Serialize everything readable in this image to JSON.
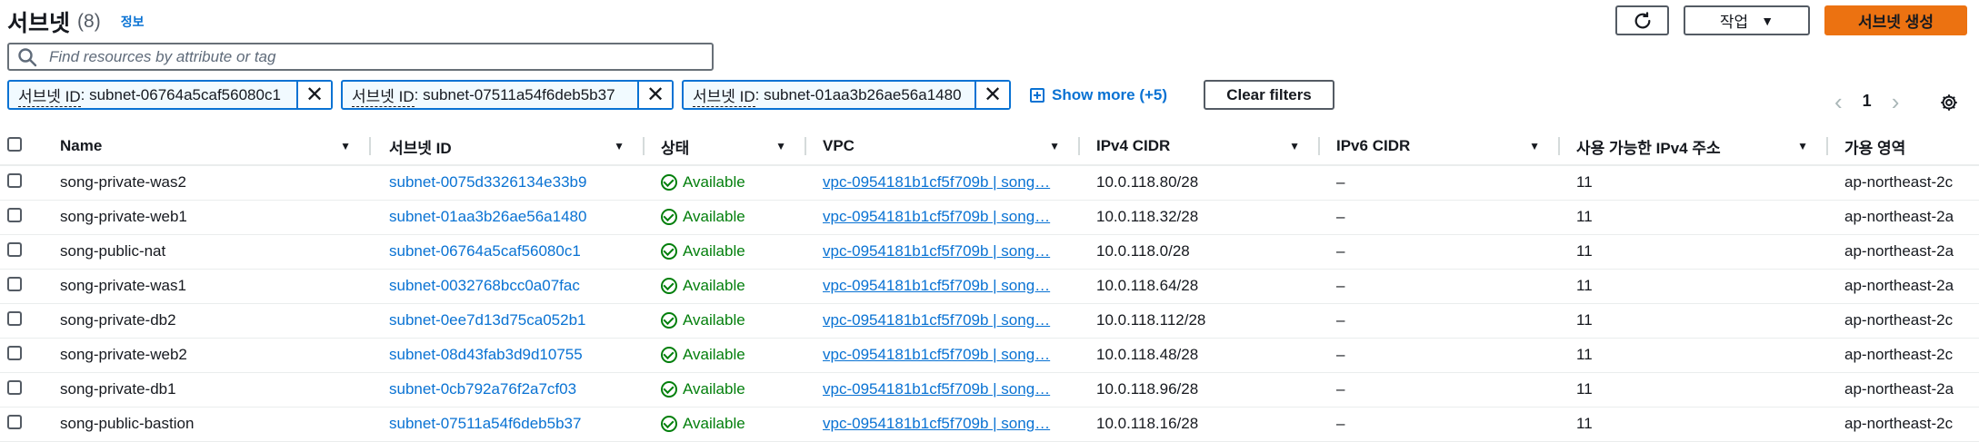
{
  "header": {
    "title": "서브넷",
    "count": "(8)",
    "info_link": "정보",
    "refresh_icon": "refresh-icon",
    "actions_label": "작업",
    "create_label": "서브넷 생성"
  },
  "search": {
    "placeholder": "Find resources by attribute or tag"
  },
  "filters": {
    "tokens": [
      {
        "key": "서브넷 ID",
        "value": " : subnet-06764a5caf56080c1"
      },
      {
        "key": "서브넷 ID",
        "value": " : subnet-07511a54f6deb5b37"
      },
      {
        "key": "서브넷 ID",
        "value": " : subnet-01aa3b26ae56a1480"
      }
    ],
    "show_more": "Show more (+5)",
    "clear_label": "Clear filters"
  },
  "pagination": {
    "page": "1"
  },
  "table": {
    "columns": [
      "Name",
      "서브넷 ID",
      "상태",
      "VPC",
      "IPv4 CIDR",
      "IPv6 CIDR",
      "사용 가능한 IPv4 주소",
      "가용 영역"
    ],
    "rows": [
      {
        "name": "song-private-was2",
        "subnet_id": "subnet-0075d3326134e33b9",
        "status": "Available",
        "vpc": "vpc-0954181b1cf5f709b | song…",
        "ipv4": "10.0.118.80/28",
        "ipv6": "–",
        "available_ips": "11",
        "az": "ap-northeast-2c"
      },
      {
        "name": "song-private-web1",
        "subnet_id": "subnet-01aa3b26ae56a1480",
        "status": "Available",
        "vpc": "vpc-0954181b1cf5f709b | song…",
        "ipv4": "10.0.118.32/28",
        "ipv6": "–",
        "available_ips": "11",
        "az": "ap-northeast-2a"
      },
      {
        "name": "song-public-nat",
        "subnet_id": "subnet-06764a5caf56080c1",
        "status": "Available",
        "vpc": "vpc-0954181b1cf5f709b | song…",
        "ipv4": "10.0.118.0/28",
        "ipv6": "–",
        "available_ips": "11",
        "az": "ap-northeast-2a"
      },
      {
        "name": "song-private-was1",
        "subnet_id": "subnet-0032768bcc0a07fac",
        "status": "Available",
        "vpc": "vpc-0954181b1cf5f709b | song…",
        "ipv4": "10.0.118.64/28",
        "ipv6": "–",
        "available_ips": "11",
        "az": "ap-northeast-2a"
      },
      {
        "name": "song-private-db2",
        "subnet_id": "subnet-0ee7d13d75ca052b1",
        "status": "Available",
        "vpc": "vpc-0954181b1cf5f709b | song…",
        "ipv4": "10.0.118.112/28",
        "ipv6": "–",
        "available_ips": "11",
        "az": "ap-northeast-2c"
      },
      {
        "name": "song-private-web2",
        "subnet_id": "subnet-08d43fab3d9d10755",
        "status": "Available",
        "vpc": "vpc-0954181b1cf5f709b | song…",
        "ipv4": "10.0.118.48/28",
        "ipv6": "–",
        "available_ips": "11",
        "az": "ap-northeast-2c"
      },
      {
        "name": "song-private-db1",
        "subnet_id": "subnet-0cb792a76f2a7cf03",
        "status": "Available",
        "vpc": "vpc-0954181b1cf5f709b | song…",
        "ipv4": "10.0.118.96/28",
        "ipv6": "–",
        "available_ips": "11",
        "az": "ap-northeast-2a"
      },
      {
        "name": "song-public-bastion",
        "subnet_id": "subnet-07511a54f6deb5b37",
        "status": "Available",
        "vpc": "vpc-0954181b1cf5f709b | song…",
        "ipv4": "10.0.118.16/28",
        "ipv6": "–",
        "available_ips": "11",
        "az": "ap-northeast-2c"
      }
    ]
  },
  "colors": {
    "accent": "#0972d3",
    "primary_button": "#ec7211",
    "success": "#037f0c"
  }
}
